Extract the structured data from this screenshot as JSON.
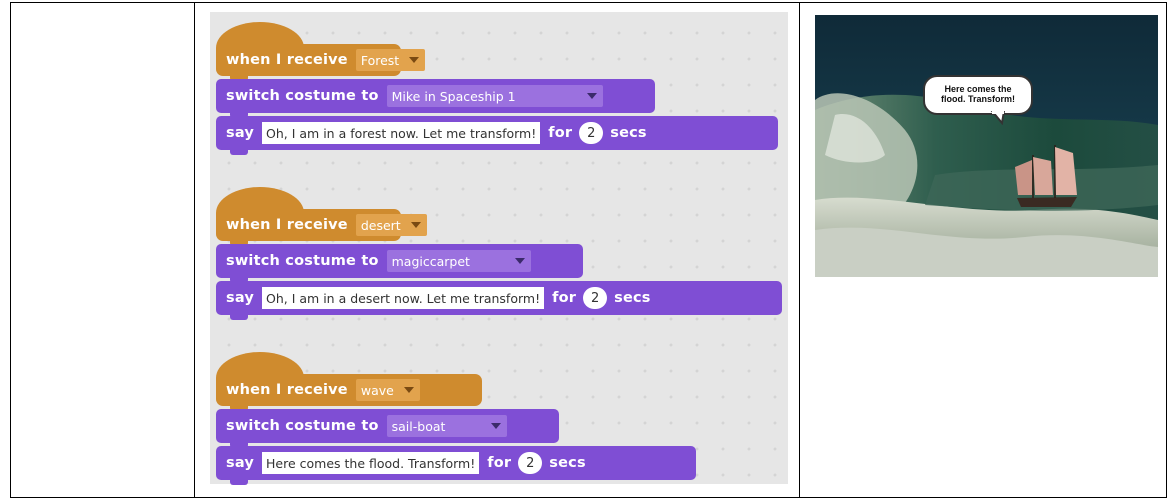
{
  "scripts": [
    {
      "hat": {
        "keyword": "when I receive",
        "message": "Forest"
      },
      "switch": {
        "keyword": "switch costume to",
        "costume": "Mike in Spaceship 1"
      },
      "say": {
        "keyword": "say",
        "text": "Oh, I am in a forest now. Let me transform!",
        "for_label": "for",
        "seconds": "2",
        "secs_label": "secs"
      }
    },
    {
      "hat": {
        "keyword": "when I receive",
        "message": "desert"
      },
      "switch": {
        "keyword": "switch costume to",
        "costume": "magiccarpet"
      },
      "say": {
        "keyword": "say",
        "text": "Oh, I am in a desert now. Let me transform!",
        "for_label": "for",
        "seconds": "2",
        "secs_label": "secs"
      }
    },
    {
      "hat": {
        "keyword": "when I receive",
        "message": "wave"
      },
      "switch": {
        "keyword": "switch costume to",
        "costume": "sail-boat"
      },
      "say": {
        "keyword": "say",
        "text": "Here comes the flood. Transform!",
        "for_label": "for",
        "seconds": "2",
        "secs_label": "secs"
      }
    }
  ],
  "stage": {
    "speech_line1": "Here comes the",
    "speech_line2": "flood. Transform!"
  },
  "colors": {
    "events": "#cf8b2e",
    "looks": "#7f4ed4",
    "scripts_bg": "#e6e6e6"
  }
}
